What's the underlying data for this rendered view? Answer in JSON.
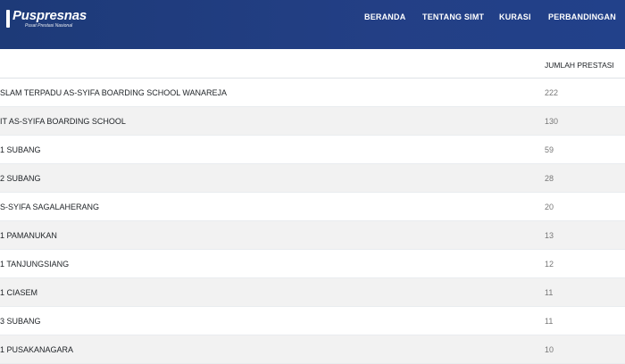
{
  "header": {
    "logo": {
      "name": "Puspresnas",
      "subtitle": "Pusat Prestasi Nasional"
    },
    "nav": [
      {
        "label": "BERANDA"
      },
      {
        "label": "TENTANG SIMT"
      },
      {
        "label": "KURASI"
      },
      {
        "label": "PERBANDINGAN"
      }
    ]
  },
  "table": {
    "headers": {
      "count": "JUMLAH PRESTASI"
    },
    "rows": [
      {
        "name": "SLAM TERPADU AS-SYIFA BOARDING SCHOOL WANAREJA",
        "count": "222"
      },
      {
        "name": "IT AS-SYIFA BOARDING SCHOOL",
        "count": "130"
      },
      {
        "name": "1 SUBANG",
        "count": "59"
      },
      {
        "name": "2 SUBANG",
        "count": "28"
      },
      {
        "name": "S-SYIFA SAGALAHERANG",
        "count": "20"
      },
      {
        "name": "1 PAMANUKAN",
        "count": "13"
      },
      {
        "name": "1 TANJUNGSIANG",
        "count": "12"
      },
      {
        "name": "1 CIASEM",
        "count": "11"
      },
      {
        "name": "3 SUBANG",
        "count": "11"
      },
      {
        "name": "1 PUSAKANAGARA",
        "count": "10"
      }
    ]
  },
  "colors": {
    "navbar": "#233f85",
    "row_stripe": "#f2f2f2",
    "count_text": "#777777"
  }
}
